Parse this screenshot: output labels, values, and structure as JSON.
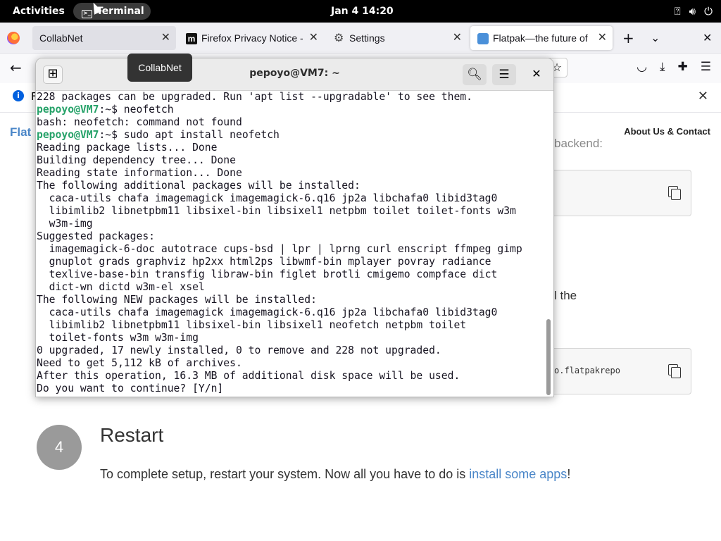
{
  "topbar": {
    "activities": "Activities",
    "app_name": "Terminal",
    "clock": "Jan 4  14:20",
    "tray_icons": [
      "accessibility-icon",
      "volume-icon",
      "power-icon"
    ]
  },
  "firefox": {
    "tabs": [
      {
        "label": "CollabNet",
        "icon": "firefox-icon"
      },
      {
        "label": "Firefox Privacy Notice -",
        "icon": "mozilla-icon"
      },
      {
        "label": "Settings",
        "icon": "gear-icon"
      },
      {
        "label": "Flatpak—the future of",
        "icon": "flatpak-icon"
      }
    ],
    "new_tab": "+",
    "list_all_tabs": "⌄",
    "close_window": "✕",
    "tooltip": "CollabNet",
    "notice_initial": "F"
  },
  "page": {
    "brand": "Flat",
    "about": "About Us & Contact",
    "backend_fragment": "backend:",
    "the_fragment": "l the",
    "code_fragment": "o.flatpakrepo",
    "step_number": "4",
    "step_title": "Restart",
    "step_desc_prefix": "To complete setup, restart your system. Now all you have to do is ",
    "step_desc_link": "install some apps",
    "step_desc_suffix": "!"
  },
  "terminal": {
    "title": "pepoyo@VM7: ~",
    "lines": [
      {
        "prompt": "",
        "text": "228 packages can be upgraded. Run 'apt list --upgradable' to see them."
      },
      {
        "prompt": "pepoyo@VM7",
        "text": ":~$ neofetch"
      },
      {
        "prompt": "",
        "text": "bash: neofetch: command not found"
      },
      {
        "prompt": "pepoyo@VM7",
        "text": ":~$ sudo apt install neofetch"
      },
      {
        "prompt": "",
        "text": "Reading package lists... Done"
      },
      {
        "prompt": "",
        "text": "Building dependency tree... Done"
      },
      {
        "prompt": "",
        "text": "Reading state information... Done"
      },
      {
        "prompt": "",
        "text": "The following additional packages will be installed:"
      },
      {
        "prompt": "",
        "text": "  caca-utils chafa imagemagick imagemagick-6.q16 jp2a libchafa0 libid3tag0"
      },
      {
        "prompt": "",
        "text": "  libimlib2 libnetpbm11 libsixel-bin libsixel1 netpbm toilet toilet-fonts w3m"
      },
      {
        "prompt": "",
        "text": "  w3m-img"
      },
      {
        "prompt": "",
        "text": "Suggested packages:"
      },
      {
        "prompt": "",
        "text": "  imagemagick-6-doc autotrace cups-bsd | lpr | lprng curl enscript ffmpeg gimp"
      },
      {
        "prompt": "",
        "text": "  gnuplot grads graphviz hp2xx html2ps libwmf-bin mplayer povray radiance"
      },
      {
        "prompt": "",
        "text": "  texlive-base-bin transfig libraw-bin figlet brotli cmigemo compface dict"
      },
      {
        "prompt": "",
        "text": "  dict-wn dictd w3m-el xsel"
      },
      {
        "prompt": "",
        "text": "The following NEW packages will be installed:"
      },
      {
        "prompt": "",
        "text": "  caca-utils chafa imagemagick imagemagick-6.q16 jp2a libchafa0 libid3tag0"
      },
      {
        "prompt": "",
        "text": "  libimlib2 libnetpbm11 libsixel-bin libsixel1 neofetch netpbm toilet"
      },
      {
        "prompt": "",
        "text": "  toilet-fonts w3m w3m-img"
      },
      {
        "prompt": "",
        "text": "0 upgraded, 17 newly installed, 0 to remove and 228 not upgraded."
      },
      {
        "prompt": "",
        "text": "Need to get 5,112 kB of archives."
      },
      {
        "prompt": "",
        "text": "After this operation, 16.3 MB of additional disk space will be used."
      },
      {
        "prompt": "",
        "text": "Do you want to continue? [Y/n]"
      }
    ]
  }
}
